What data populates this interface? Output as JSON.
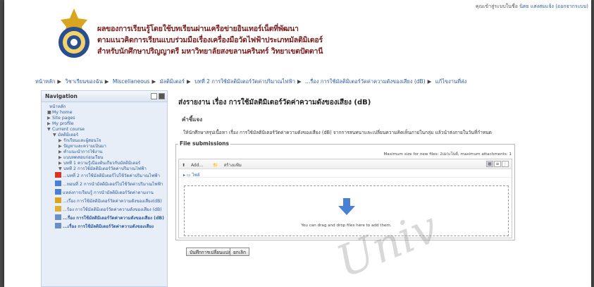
{
  "header": {
    "title_lines": [
      "ผลของการเรียนรู้โดยใช้บทเรียนผ่านเครือข่ายอินเทอร์เน็ตที่พัฒนา",
      "ตามแนวคิดการเรียนแบบร่วมมือเรื่องเครื่องมือวัดไฟฟ้าประเภทมัลติมิเตอร์",
      "สำหรับนักศึกษาปริญญาตรี มหาวิทยาลัยสงขลานครินทร์ วิทยาเขตปัตตานี"
    ],
    "login_prefix": "คุณเข้าสู่ระบบในชื่อ",
    "login_user": "นิตย แสงสมแจ้ง",
    "login_logout": "(ออกจากระบบ)"
  },
  "breadcrumb": [
    "หน้าหลัก",
    "วิชาเรียนของฉัน",
    "Miscellaneous",
    "มัลติมิเตอร์",
    "บทที่ 2 การใช้มัลติมิเตอร์วัดค่าปริมาณไฟฟ้า",
    "...รื่อง การใช้มัลติมิเตอร์วัดค่าความดังของเสียง (dB)",
    "แก้ไขงานที่ส่ง"
  ],
  "sidebar": {
    "title": "Navigation",
    "items": [
      {
        "label": "หน้าหลัก",
        "level": 0,
        "arrow": ""
      },
      {
        "label": "My home",
        "level": 1,
        "arrow": "■"
      },
      {
        "label": "Site pages",
        "level": 1,
        "arrow": "▶"
      },
      {
        "label": "My profile",
        "level": 1,
        "arrow": "▶"
      },
      {
        "label": "Current course",
        "level": 1,
        "arrow": "▼"
      },
      {
        "label": "มัลติมิเตอร์",
        "level": 2,
        "arrow": "▼"
      },
      {
        "label": "รักเรียนและผู้สอนใจ",
        "level": 3,
        "arrow": "▶"
      },
      {
        "label": "ปัญหาและความเป็นมา",
        "level": 3,
        "arrow": "▶"
      },
      {
        "label": "คำแนะนำการใช้งาน",
        "level": 3,
        "arrow": "▶"
      },
      {
        "label": "แบบทดสอบก่อนเรียน",
        "level": 3,
        "arrow": "▶"
      },
      {
        "label": "บทที่ 1 ความรู้เบื้องต้นเกี่ยวกับมัลติมิเตอร์",
        "level": 3,
        "arrow": "▶"
      },
      {
        "label": "บทที่ 2 การใช้มัลติมิเตอร์วัดค่าปริมาณไฟฟ้า",
        "level": 3,
        "arrow": "▼"
      }
    ],
    "activities": [
      {
        "label": "...บทที่ 2 การใช้มัลติมิเตอร์ไปใช้วัดค่าปริมาณไฟฟ้า",
        "icon": "pin"
      },
      {
        "label": "...ทอนที่ 2 การนำมัลติมิเตอร์ไปใช้วัดค่าปริมาณไฟฟ้า",
        "icon": "doc"
      },
      {
        "label": "แหล่งการเรียนรู้ การนำมัลติมิเตอร์วัดค่าตามงาน",
        "icon": "doc"
      },
      {
        "label": "...เรื่อง การใช้มัลติมิเตอร์วัดค่าความดังของเสียง(dB)",
        "icon": "forum"
      },
      {
        "label": "...ร้อง การใช้มัลติมิเตอร์วัดค่าความดังของเสียง (dB)",
        "icon": "chat"
      },
      {
        "label": "...รื่อง การใช้มัลติมิเตอร์วัดค่าความดังของเสียง (dB)",
        "icon": "assign",
        "bold": true
      },
      {
        "label": "...เรื่อง การใช้มัลติมิเตอร์วัดค่าความดังของเสียง",
        "icon": "assign",
        "bold": true
      }
    ]
  },
  "main": {
    "title": "ส่งรายงาน เรื่อง การใช้มัลติมิเตอร์วัดค่าความดังของเสียง (dB)",
    "desc_heading": "คำชี้แจง",
    "desc_text": "ให้นักศึกษาสรุปเนื้อหา เรื่อง การใช้มัลติมิเตอร์วัดค่าความดังของเสียง (dB) จากการสนทนาและเปลี่ยนความคิดเห็นภายในกลุ่ม แล้วนำส่งภายในวันที่กำหนด",
    "fieldset_legend": "File submissions",
    "max_size": "Maximum size for new files: 2เมกะไบต์, maximum attachments: 1",
    "add_label": "Add...",
    "create_folder_label": "สร้างแฟ้ม",
    "path_label": "ไฟล์",
    "drop_text": "You can drag and drop files here to add them.",
    "save_label": "บันทึกการเปลี่ยนแปลง",
    "cancel_label": "ยกเลิก"
  },
  "watermark": "Univ",
  "colors": {
    "title": "#7a1f1f",
    "link": "#2a5aa0",
    "sidebar_bg": "#e8eef7",
    "arrow": "#4a7fd6"
  }
}
